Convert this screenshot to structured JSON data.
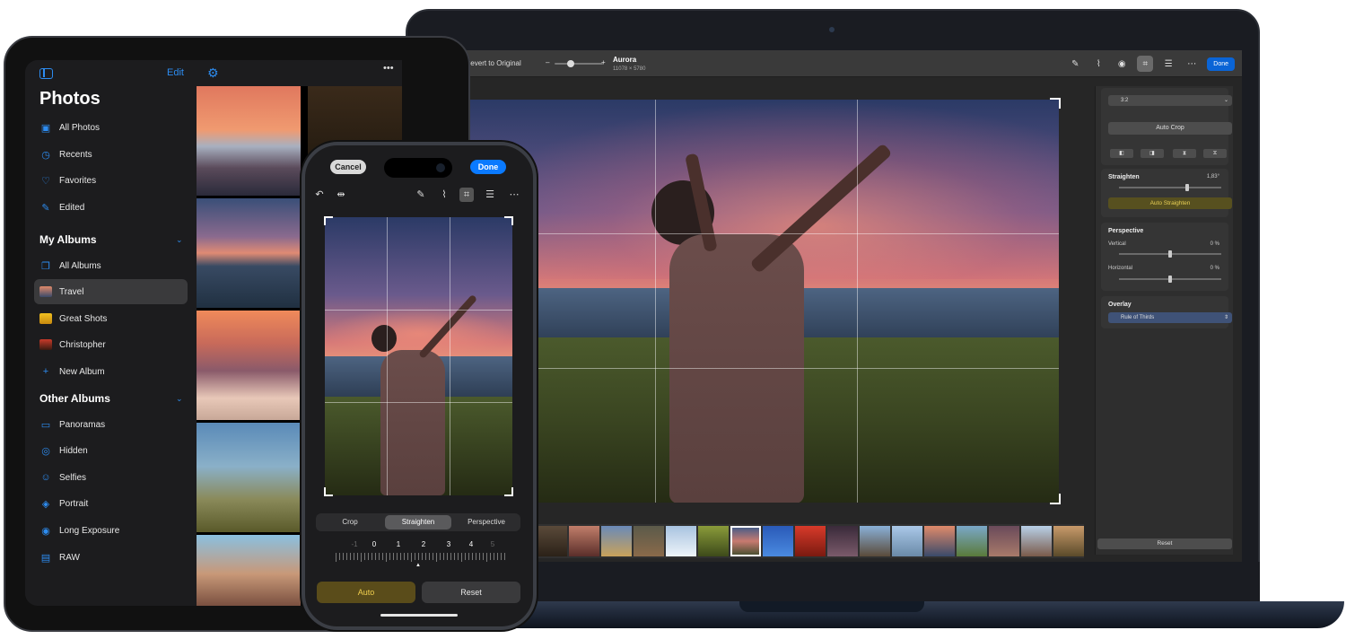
{
  "mac": {
    "toolbar": {
      "revert_label": "Revert to Original",
      "slider_minus": "–",
      "slider_plus": "+",
      "photo_title": "Aurora",
      "photo_dims": "11078 × 5780",
      "done_label": "Done"
    },
    "sidebar": {
      "aspect": "3:2",
      "auto_crop": "Auto Crop",
      "straighten_label": "Straighten",
      "straighten_value": "1,83°",
      "auto_straighten": "Auto Straighten",
      "perspective_label": "Perspective",
      "vertical_label": "Vertical",
      "vertical_value": "0 %",
      "horizontal_label": "Horizontal",
      "horizontal_value": "0 %",
      "overlay_label": "Overlay",
      "overlay_value": "Rule of Thirds",
      "reset_label": "Reset"
    }
  },
  "ipad": {
    "edit_label": "Edit",
    "title": "Photos",
    "library": [
      {
        "label": "All Photos",
        "icon": "photos-icon"
      },
      {
        "label": "Recents",
        "icon": "clock-icon"
      },
      {
        "label": "Favorites",
        "icon": "heart-icon"
      },
      {
        "label": "Edited",
        "icon": "edit-icon"
      }
    ],
    "my_albums_heading": "My Albums",
    "my_albums": [
      {
        "label": "All Albums",
        "icon": "albums-icon"
      },
      {
        "label": "Travel",
        "icon": "album-thumb-icon",
        "selected": true
      },
      {
        "label": "Great Shots",
        "icon": "album-thumb-icon"
      },
      {
        "label": "Christopher",
        "icon": "album-thumb-icon"
      },
      {
        "label": "New Album",
        "icon": "plus-icon"
      }
    ],
    "other_albums_heading": "Other Albums",
    "other_albums": [
      {
        "label": "Panoramas",
        "icon": "panorama-icon"
      },
      {
        "label": "Hidden",
        "icon": "eye-slash-icon"
      },
      {
        "label": "Selfies",
        "icon": "selfie-icon"
      },
      {
        "label": "Portrait",
        "icon": "cube-icon"
      },
      {
        "label": "Long Exposure",
        "icon": "exposure-icon"
      },
      {
        "label": "RAW",
        "icon": "raw-icon"
      }
    ]
  },
  "iphone": {
    "cancel_label": "Cancel",
    "done_label": "Done",
    "tabs": [
      "Crop",
      "Straighten",
      "Perspective"
    ],
    "selected_tab": "Straighten",
    "ruler_numbers": [
      "-1",
      "0",
      "1",
      "2",
      "3",
      "4",
      "5"
    ],
    "ruler_value": 2,
    "auto_label": "Auto",
    "reset_label": "Reset"
  },
  "colors": {
    "accent_blue": "#0a64d6",
    "auto_yellow": "#e8cf56"
  }
}
